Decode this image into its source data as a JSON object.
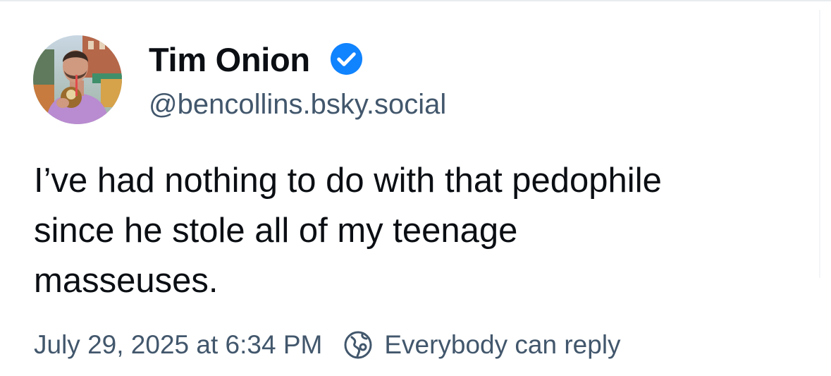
{
  "author": {
    "display_name": "Tim Onion",
    "handle": "@bencollins.bsky.social",
    "verified": true,
    "verified_color": "#1083fe"
  },
  "post": {
    "lines": [
      "I’ve had nothing to do with that pedophile",
      "since he stole all of my teenage",
      "masseuses."
    ]
  },
  "meta": {
    "timestamp": "July 29, 2025 at 6:34 PM",
    "reply_setting": "Everybody can reply",
    "reply_icon": "globe-icon"
  },
  "colors": {
    "text_primary": "#0b0f14",
    "text_secondary": "#42576c",
    "background": "#ffffff"
  }
}
